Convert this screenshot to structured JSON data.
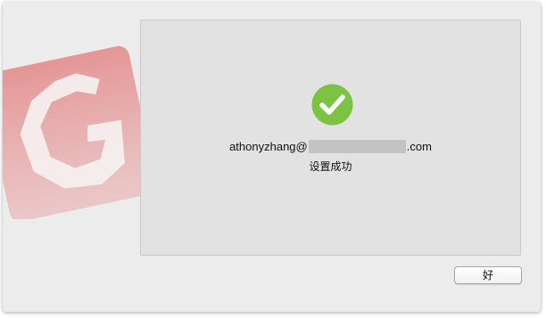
{
  "logo": {
    "icon": "g-logo-icon",
    "color": "#e06b6b"
  },
  "dialog": {
    "status_icon": "checkmark-circle-icon",
    "status_color": "#7cc243",
    "email_prefix": "athonyzhang@",
    "email_suffix": ".com",
    "message": "设置成功"
  },
  "buttons": {
    "ok_label": "好"
  }
}
